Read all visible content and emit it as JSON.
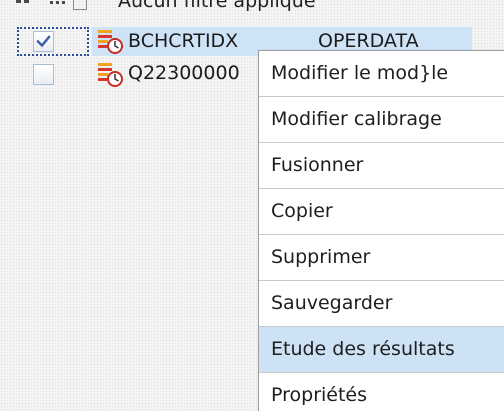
{
  "filter": {
    "label": "Aucun filtre appliqué",
    "icon": "filter-dropdown-icon"
  },
  "tree": {
    "rows": [
      {
        "name": "BCHCRTIDX",
        "type": "OPERDATA",
        "checked": true,
        "selected": true,
        "icon": "scheduled-model-icon"
      },
      {
        "name": "Q22300000",
        "type": "",
        "checked": false,
        "selected": false,
        "icon": "scheduled-model-icon"
      }
    ]
  },
  "context_menu": {
    "items": [
      {
        "label": "Modifier le mod}le"
      },
      {
        "label": "Modifier calibrage"
      },
      {
        "label": "Fusionner"
      },
      {
        "label": "Copier"
      },
      {
        "label": "Supprimer"
      },
      {
        "label": "Sauvegarder"
      },
      {
        "label": "Etude des résultats",
        "highlighted": true
      },
      {
        "label": "Propriétés"
      }
    ]
  },
  "colors": {
    "selection": "#cfe3f6",
    "menu_hover": "#cde2f5",
    "focus_border": "#2b4f9c",
    "icon_red": "#d9342b",
    "icon_orange": "#f4a11d"
  }
}
